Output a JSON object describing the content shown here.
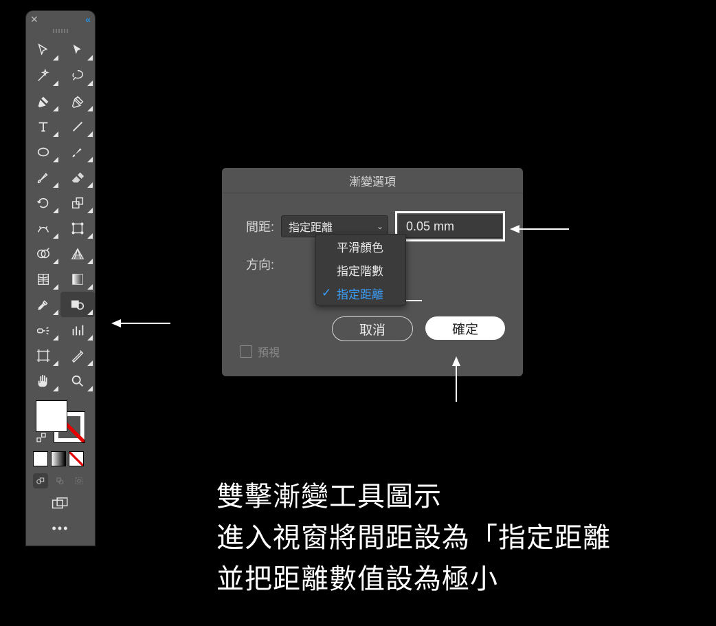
{
  "toolbar": {
    "tools": [
      {
        "name": "selection-tool"
      },
      {
        "name": "direct-selection-tool"
      },
      {
        "name": "magic-wand-tool"
      },
      {
        "name": "lasso-tool"
      },
      {
        "name": "pen-tool"
      },
      {
        "name": "curvature-tool"
      },
      {
        "name": "type-tool"
      },
      {
        "name": "line-segment-tool"
      },
      {
        "name": "ellipse-tool"
      },
      {
        "name": "paintbrush-tool"
      },
      {
        "name": "pencil-tool"
      },
      {
        "name": "eraser-tool"
      },
      {
        "name": "rotate-tool"
      },
      {
        "name": "scale-tool"
      },
      {
        "name": "width-tool"
      },
      {
        "name": "free-transform-tool"
      },
      {
        "name": "shape-builder-tool"
      },
      {
        "name": "perspective-grid-tool"
      },
      {
        "name": "mesh-tool"
      },
      {
        "name": "gradient-tool"
      },
      {
        "name": "eyedropper-tool"
      },
      {
        "name": "blend-tool"
      },
      {
        "name": "symbol-sprayer-tool"
      },
      {
        "name": "column-graph-tool"
      },
      {
        "name": "artboard-tool"
      },
      {
        "name": "slice-tool"
      },
      {
        "name": "hand-tool"
      },
      {
        "name": "zoom-tool"
      }
    ],
    "active_tool_index": 21
  },
  "dialog": {
    "title": "漸變選項",
    "spacing_label": "間距:",
    "spacing_select": "指定距離",
    "spacing_value": "0.05 mm",
    "orientation_label": "方向:",
    "options": [
      {
        "label": "平滑顏色",
        "selected": false
      },
      {
        "label": "指定階數",
        "selected": false
      },
      {
        "label": "指定距離",
        "selected": true
      }
    ],
    "preview_label": "預視",
    "cancel": "取消",
    "ok": "確定"
  },
  "caption": {
    "line1": "雙擊漸變工具圖示",
    "line2": "進入視窗將間距設為「指定距離",
    "line3": "並把距離數值設為極小"
  }
}
